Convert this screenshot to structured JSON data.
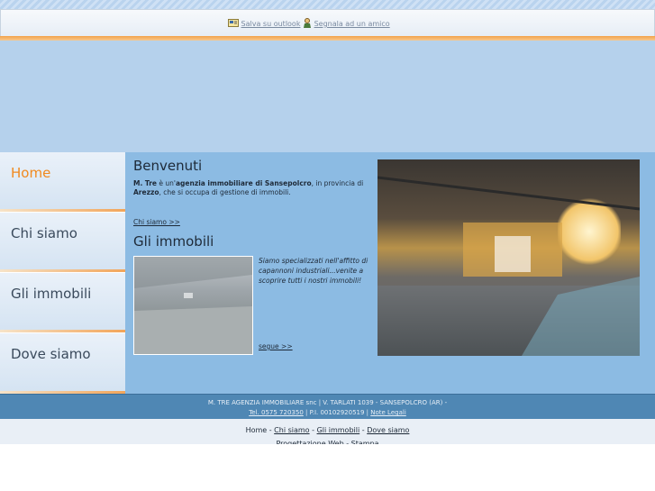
{
  "toolbar": {
    "save_outlook": "Salva su outlook",
    "tell_friend": "Segnala ad un amico"
  },
  "nav": [
    "Home",
    "Chi siamo",
    "Gli immobili",
    "Dove siamo"
  ],
  "welcome": {
    "title": "Benvenuti",
    "company": "M. Tre",
    "t1": " è un'",
    "strong2": "agenzia immobiliare di Sansepolcro",
    "t2": ", in provincia di",
    "strong3": "Arezzo",
    "t3": ", che si occupa di gestione di immobili.",
    "link": "Chi siamo >>"
  },
  "properties": {
    "title": "Gli immobili",
    "text": "Siamo specializzati nell'affitto di capannoni industriali...venite a scoprire tutti i nostri immobili!",
    "link": "segue >>"
  },
  "footer": {
    "line1": "M. TRE AGENZIA IMMOBILIARE snc | V. TARLATI 1039 - SANSEPOLCRO (AR) -",
    "tel": "Tel. 0575 720350",
    "piva": " | P.I. 00102920519 | ",
    "legal": "Note Legali"
  },
  "bottom_nav": [
    "Home",
    "Chi siamo",
    "Gli immobili",
    "Dove siamo"
  ],
  "bottom_nav_sep": " - ",
  "bottom_cut": "Progettazione Web - Stampa"
}
